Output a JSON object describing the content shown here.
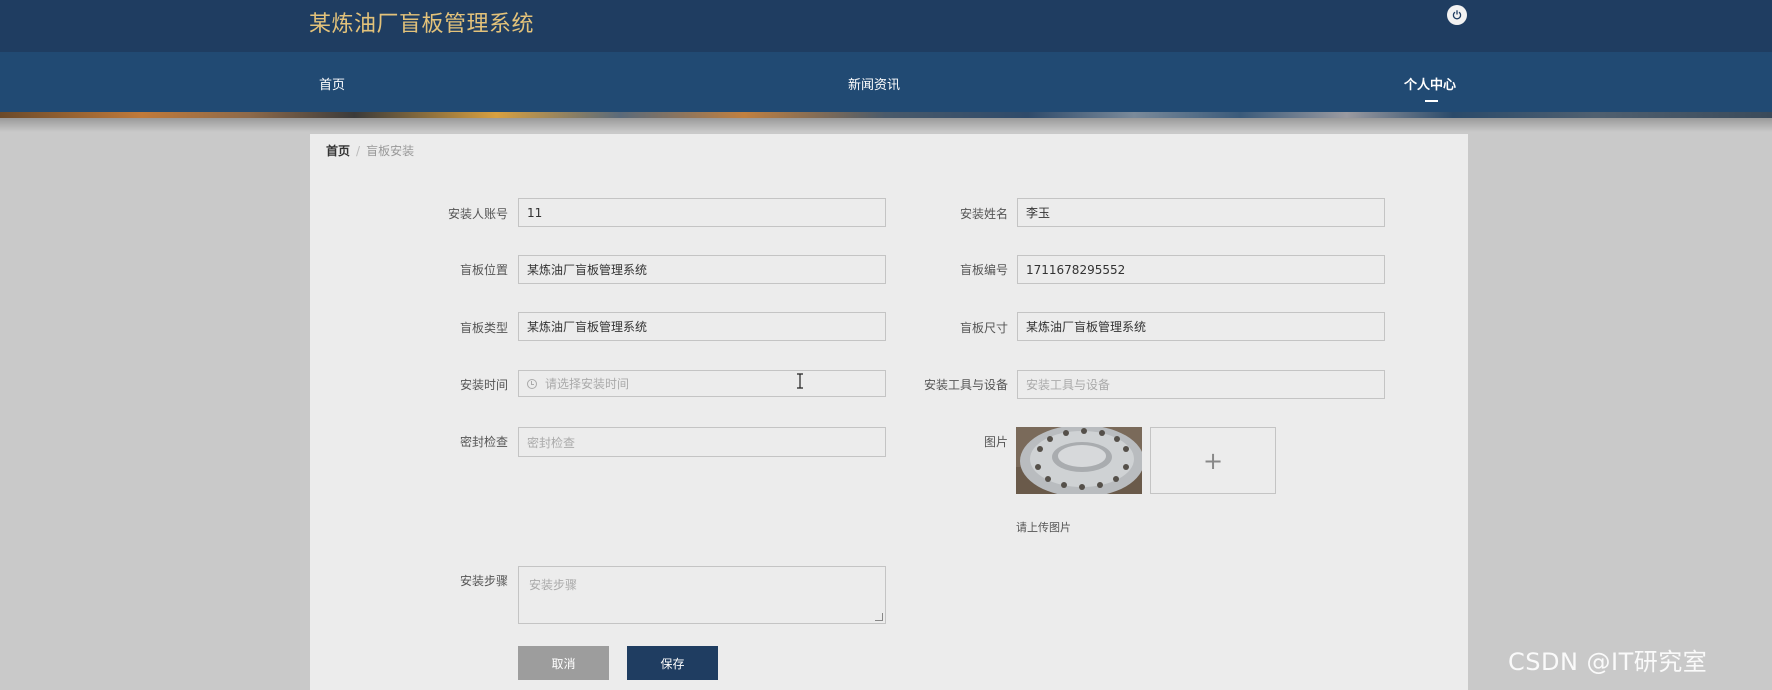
{
  "header": {
    "app_title": "某炼油厂盲板管理系统",
    "power_icon": "power-icon"
  },
  "nav": {
    "items": [
      {
        "label": "首页"
      },
      {
        "label": "新闻资讯"
      },
      {
        "label": "个人中心"
      }
    ],
    "active_item": "个人中心"
  },
  "breadcrumb": {
    "home": "首页",
    "separator": "/",
    "current": "盲板安装"
  },
  "form": {
    "installer_account": {
      "label": "安装人账号",
      "value": "11"
    },
    "installer_name": {
      "label": "安装姓名",
      "value": "李玉"
    },
    "blind_location": {
      "label": "盲板位置",
      "value": "某炼油厂盲板管理系统"
    },
    "blind_number": {
      "label": "盲板编号",
      "value": "1711678295552"
    },
    "blind_type": {
      "label": "盲板类型",
      "value": "某炼油厂盲板管理系统"
    },
    "blind_size": {
      "label": "盲板尺寸",
      "value": "某炼油厂盲板管理系统"
    },
    "install_time": {
      "label": "安装时间",
      "placeholder": "请选择安装时间"
    },
    "tools": {
      "label": "安装工具与设备",
      "placeholder": "安装工具与设备"
    },
    "seal_check": {
      "label": "密封检查",
      "placeholder": "密封检查"
    },
    "image": {
      "label": "图片",
      "upload_symbol": "+",
      "hint": "请上传图片"
    },
    "install_steps": {
      "label": "安装步骤",
      "placeholder": "安装步骤"
    }
  },
  "buttons": {
    "cancel": "取消",
    "save": "保存"
  },
  "watermark": "CSDN @IT研究室",
  "colors": {
    "header_bg": "#1f3d61",
    "nav_bg": "#214a73",
    "title_gold": "#e3c27a",
    "save_btn": "#1f3d61",
    "cancel_btn": "#9d9d9d"
  }
}
